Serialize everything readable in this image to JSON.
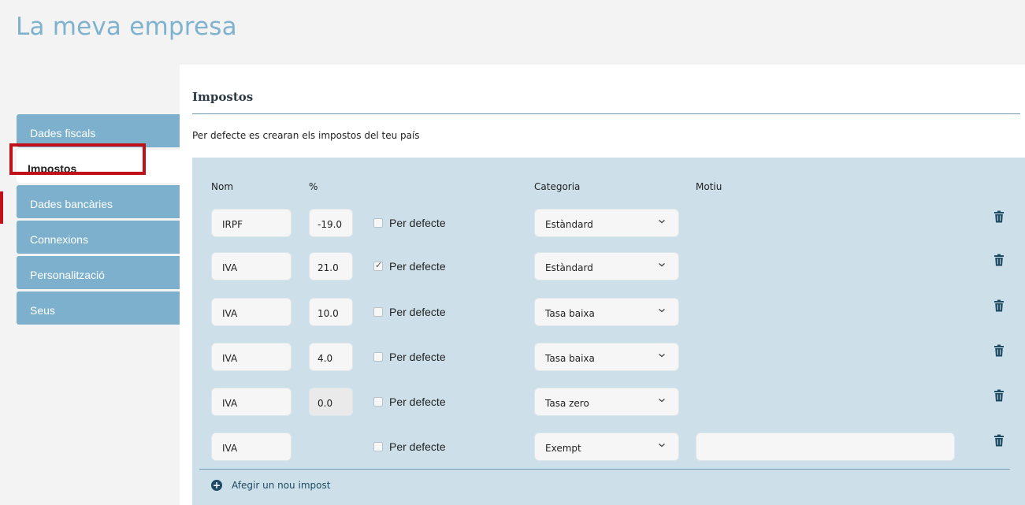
{
  "app": {
    "title": "La meva empresa"
  },
  "sidebar": {
    "items": [
      {
        "label": "Dades fiscals",
        "active": false
      },
      {
        "label": "Impostos",
        "active": true
      },
      {
        "label": "Dades bancàries",
        "active": false
      },
      {
        "label": "Connexions",
        "active": false
      },
      {
        "label": "Personalització",
        "active": false
      },
      {
        "label": "Seus",
        "active": false
      }
    ]
  },
  "section": {
    "title": "Impostos",
    "description": "Per defecte es crearan els impostos del teu país"
  },
  "table": {
    "headers": {
      "name": "Nom",
      "percent": "%",
      "category": "Categoria",
      "reason": "Motiu"
    },
    "rows": [
      {
        "name": "IRPF",
        "percent": "-19.0",
        "default_label": "Per defecte",
        "default_checked": false,
        "category": "Estàndard"
      },
      {
        "name": "IVA",
        "percent": "21.0",
        "default_label": "Per defecte",
        "default_checked": true,
        "category": "Estàndard"
      },
      {
        "name": "IVA",
        "percent": "10.0",
        "default_label": "Per defecte",
        "default_checked": false,
        "category": "Tasa baixa"
      },
      {
        "name": "IVA",
        "percent": "4.0",
        "default_label": "Per defecte",
        "default_checked": false,
        "category": "Tasa baixa"
      },
      {
        "name": "IVA",
        "percent": "0.0",
        "default_label": "Per defecte",
        "default_checked": false,
        "category": "Tasa zero"
      },
      {
        "name": "IVA",
        "percent": "",
        "default_label": "Per defecte",
        "default_checked": false,
        "category": "Exempt",
        "reason": ""
      }
    ],
    "add_label": "Afegir un nou impost"
  },
  "icons": {
    "delete": "trash-icon",
    "dropdown": "chevron-down-icon",
    "add": "plus-circle-icon"
  },
  "colors": {
    "accent": "#7cb0cd",
    "panel": "#cde0ea",
    "highlight": "#c0111a",
    "title": "#7fb2cf"
  }
}
